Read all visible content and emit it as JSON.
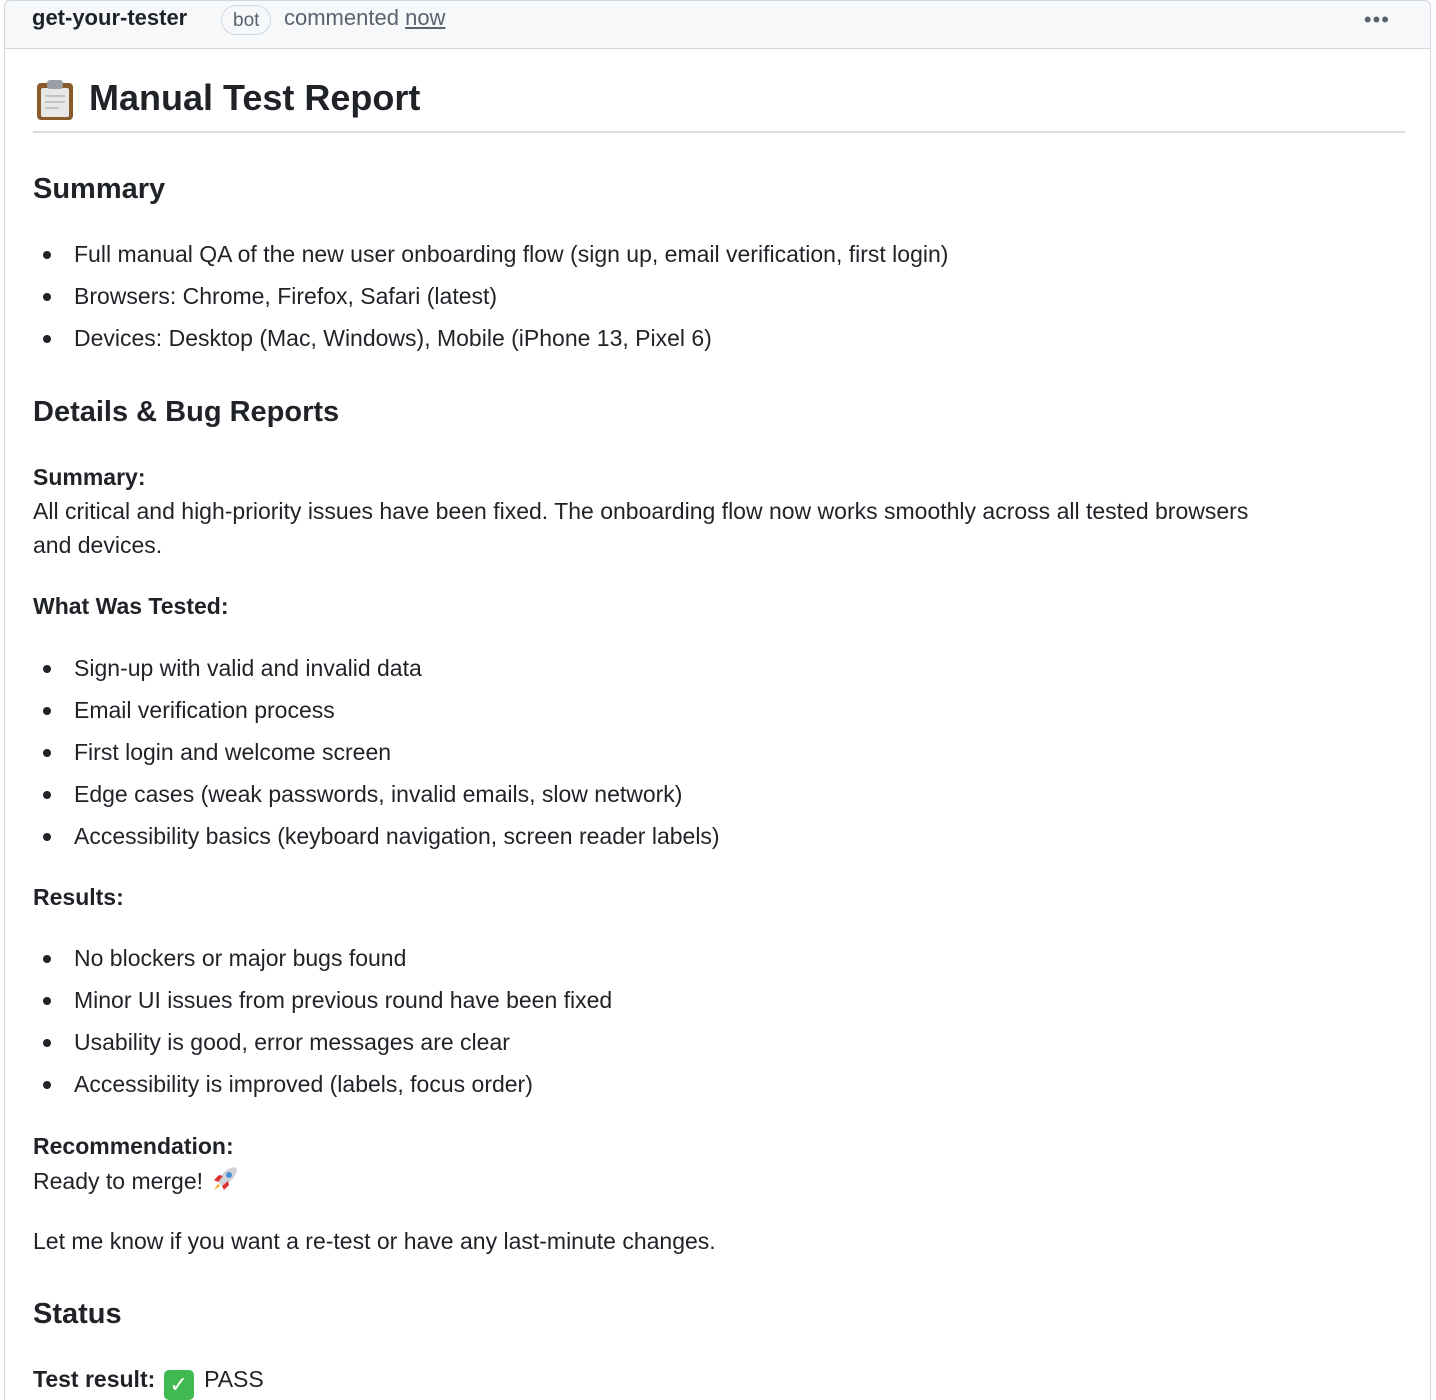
{
  "header": {
    "author": "get-your-tester",
    "badge": "bot",
    "action": "commented",
    "time": "now",
    "menu": "•••"
  },
  "report": {
    "title": "Manual Test Report",
    "summary_heading": "Summary",
    "summary_items": [
      "Full manual QA of the new user onboarding flow (sign up, email verification, first login)",
      "Browsers: Chrome, Firefox, Safari (latest)",
      "Devices: Desktop (Mac, Windows), Mobile (iPhone 13, Pixel 6)"
    ],
    "details_heading": "Details & Bug Reports",
    "details_summary_label": "Summary:",
    "details_summary_text_1": "All critical and high-priority issues have been fixed. The onboarding flow now works smoothly across all tested browsers",
    "details_summary_text_2": "and devices.",
    "tested_label": "What Was Tested:",
    "tested_items": [
      "Sign-up with valid and invalid data",
      "Email verification process",
      "First login and welcome screen",
      "Edge cases (weak passwords, invalid emails, slow network)",
      "Accessibility basics (keyboard navigation, screen reader labels)"
    ],
    "results_label": "Results:",
    "results_items": [
      "No blockers or major bugs found",
      "Minor UI issues from previous round have been fixed",
      "Usability is good, error messages are clear",
      "Accessibility is improved (labels, focus order)"
    ],
    "recommendation_label": "Recommendation:",
    "recommendation_text": "Ready to merge!",
    "followup": "Let me know if you want a re-test or have any last-minute changes.",
    "status_heading": "Status",
    "test_result_label": "Test result:",
    "test_result_value": "PASS"
  },
  "icons": {
    "clipboard": "clipboard-icon",
    "rocket": "rocket-icon",
    "check": "check-mark-icon",
    "menu": "kebab-menu-icon"
  },
  "colors": {
    "pass_green": "#3fb950",
    "muted": "#59636e",
    "border": "#d0d7de"
  }
}
